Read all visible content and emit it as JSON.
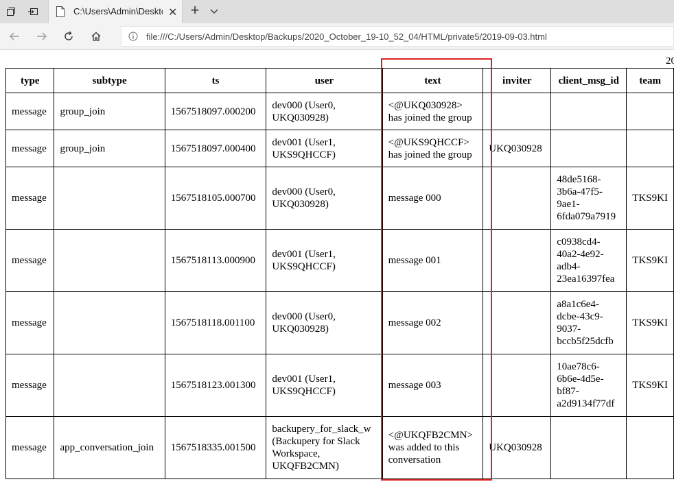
{
  "browser": {
    "tab_title": "C:\\Users\\Admin\\Deskto",
    "address_url": "file:///C:/Users/Admin/Desktop/Backups/2020_October_19-10_52_04/HTML/private5/2019-09-03.html"
  },
  "page": {
    "page_number": "20",
    "columns": [
      "type",
      "subtype",
      "ts",
      "user",
      "text",
      "inviter",
      "client_msg_id",
      "team"
    ],
    "rows": [
      {
        "type": "message",
        "subtype": "group_join",
        "ts": "1567518097.000200",
        "user": [
          "dev000 (User0,",
          "UKQ030928)"
        ],
        "text": [
          "<@UKQ030928>",
          "has joined the group"
        ],
        "inviter": "",
        "client_msg_id": [],
        "team": ""
      },
      {
        "type": "message",
        "subtype": "group_join",
        "ts": "1567518097.000400",
        "user": [
          "dev001 (User1,",
          "UKS9QHCCF)"
        ],
        "text": [
          "<@UKS9QHCCF>",
          "has joined the group"
        ],
        "inviter": "UKQ030928",
        "client_msg_id": [],
        "team": ""
      },
      {
        "type": "message",
        "subtype": "",
        "ts": "1567518105.000700",
        "user": [
          "dev000 (User0,",
          "UKQ030928)"
        ],
        "text": [
          "message 000"
        ],
        "inviter": "",
        "client_msg_id": [
          "48de5168-",
          "3b6a-47f5-",
          "9ae1-",
          "6fda079a7919"
        ],
        "team": "TKS9KI"
      },
      {
        "type": "message",
        "subtype": "",
        "ts": "1567518113.000900",
        "user": [
          "dev001 (User1,",
          "UKS9QHCCF)"
        ],
        "text": [
          "message 001"
        ],
        "inviter": "",
        "client_msg_id": [
          "c0938cd4-",
          "40a2-4e92-",
          "adb4-",
          "23ea16397fea"
        ],
        "team": "TKS9KI"
      },
      {
        "type": "message",
        "subtype": "",
        "ts": "1567518118.001100",
        "user": [
          "dev000 (User0,",
          "UKQ030928)"
        ],
        "text": [
          "message 002"
        ],
        "inviter": "",
        "client_msg_id": [
          "a8a1c6e4-",
          "dcbe-43c9-",
          "9037-",
          "bccb5f25dcfb"
        ],
        "team": "TKS9KI"
      },
      {
        "type": "message",
        "subtype": "",
        "ts": "1567518123.001300",
        "user": [
          "dev001 (User1,",
          "UKS9QHCCF)"
        ],
        "text": [
          "message 003"
        ],
        "inviter": "",
        "client_msg_id": [
          "10ae78c6-",
          "6b6e-4d5e-",
          "bf87-",
          "a2d9134f77df"
        ],
        "team": "TKS9KI"
      },
      {
        "type": "message",
        "subtype": "app_conversation_join",
        "ts": "1567518335.001500",
        "user": [
          "backupery_for_slack_w",
          "(Backupery for Slack",
          "Workspace,",
          "UKQFB2CMN)"
        ],
        "text": [
          "<@UKQFB2CMN>",
          "was added to this",
          "conversation"
        ],
        "inviter": "UKQ030928",
        "client_msg_id": [],
        "team": ""
      }
    ]
  }
}
